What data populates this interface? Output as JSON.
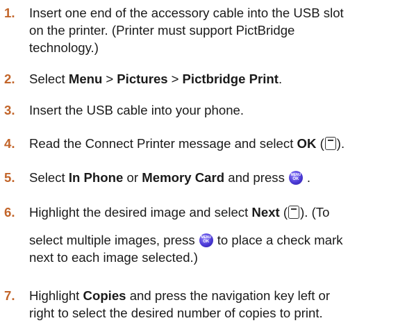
{
  "steps": [
    {
      "number": "1.",
      "lines": [
        "Insert one end of the accessory cable into the USB slot",
        "on the printer. (Printer must support PictBridge",
        "technology.)"
      ]
    },
    {
      "number": "2.",
      "prefix": "Select ",
      "menu": "Menu",
      "sep1": ">",
      "pictures": "Pictures",
      "sep2": ">",
      "print": "Pictbridge Print",
      "suffix": "."
    },
    {
      "number": "3.",
      "text": "Insert the USB cable into your phone."
    },
    {
      "number": "4.",
      "prefix": "Read the Connect Printer message and select ",
      "ok": "OK",
      "open": " (",
      "close": ")."
    },
    {
      "number": "5.",
      "prefix": "Select ",
      "in_phone": "In Phone",
      "or": " or ",
      "memory_card": "Memory Card",
      "press": " and press",
      "end": "."
    },
    {
      "number": "6.",
      "prefix": "Highlight the desired image and select ",
      "next": "Next",
      "open": " (",
      "close": "). (To",
      "line2a": "select multiple images, press",
      "line2b": "to place a check mark",
      "line3": "next to each image selected.)"
    },
    {
      "number": "7.",
      "bold": "Copies",
      "prefix": "Highlight ",
      "rest1": " and press the navigation key left or",
      "line2": "right to select the desired number of copies to print."
    }
  ],
  "keys": {
    "softkey_glyph": "···",
    "menu_ok_top": "MENU",
    "menu_ok_bottom": "OK"
  },
  "colors": {
    "step_number": "#c2652a",
    "text": "#1a1a1a",
    "menu_ok_button": "#4b3ad6"
  }
}
